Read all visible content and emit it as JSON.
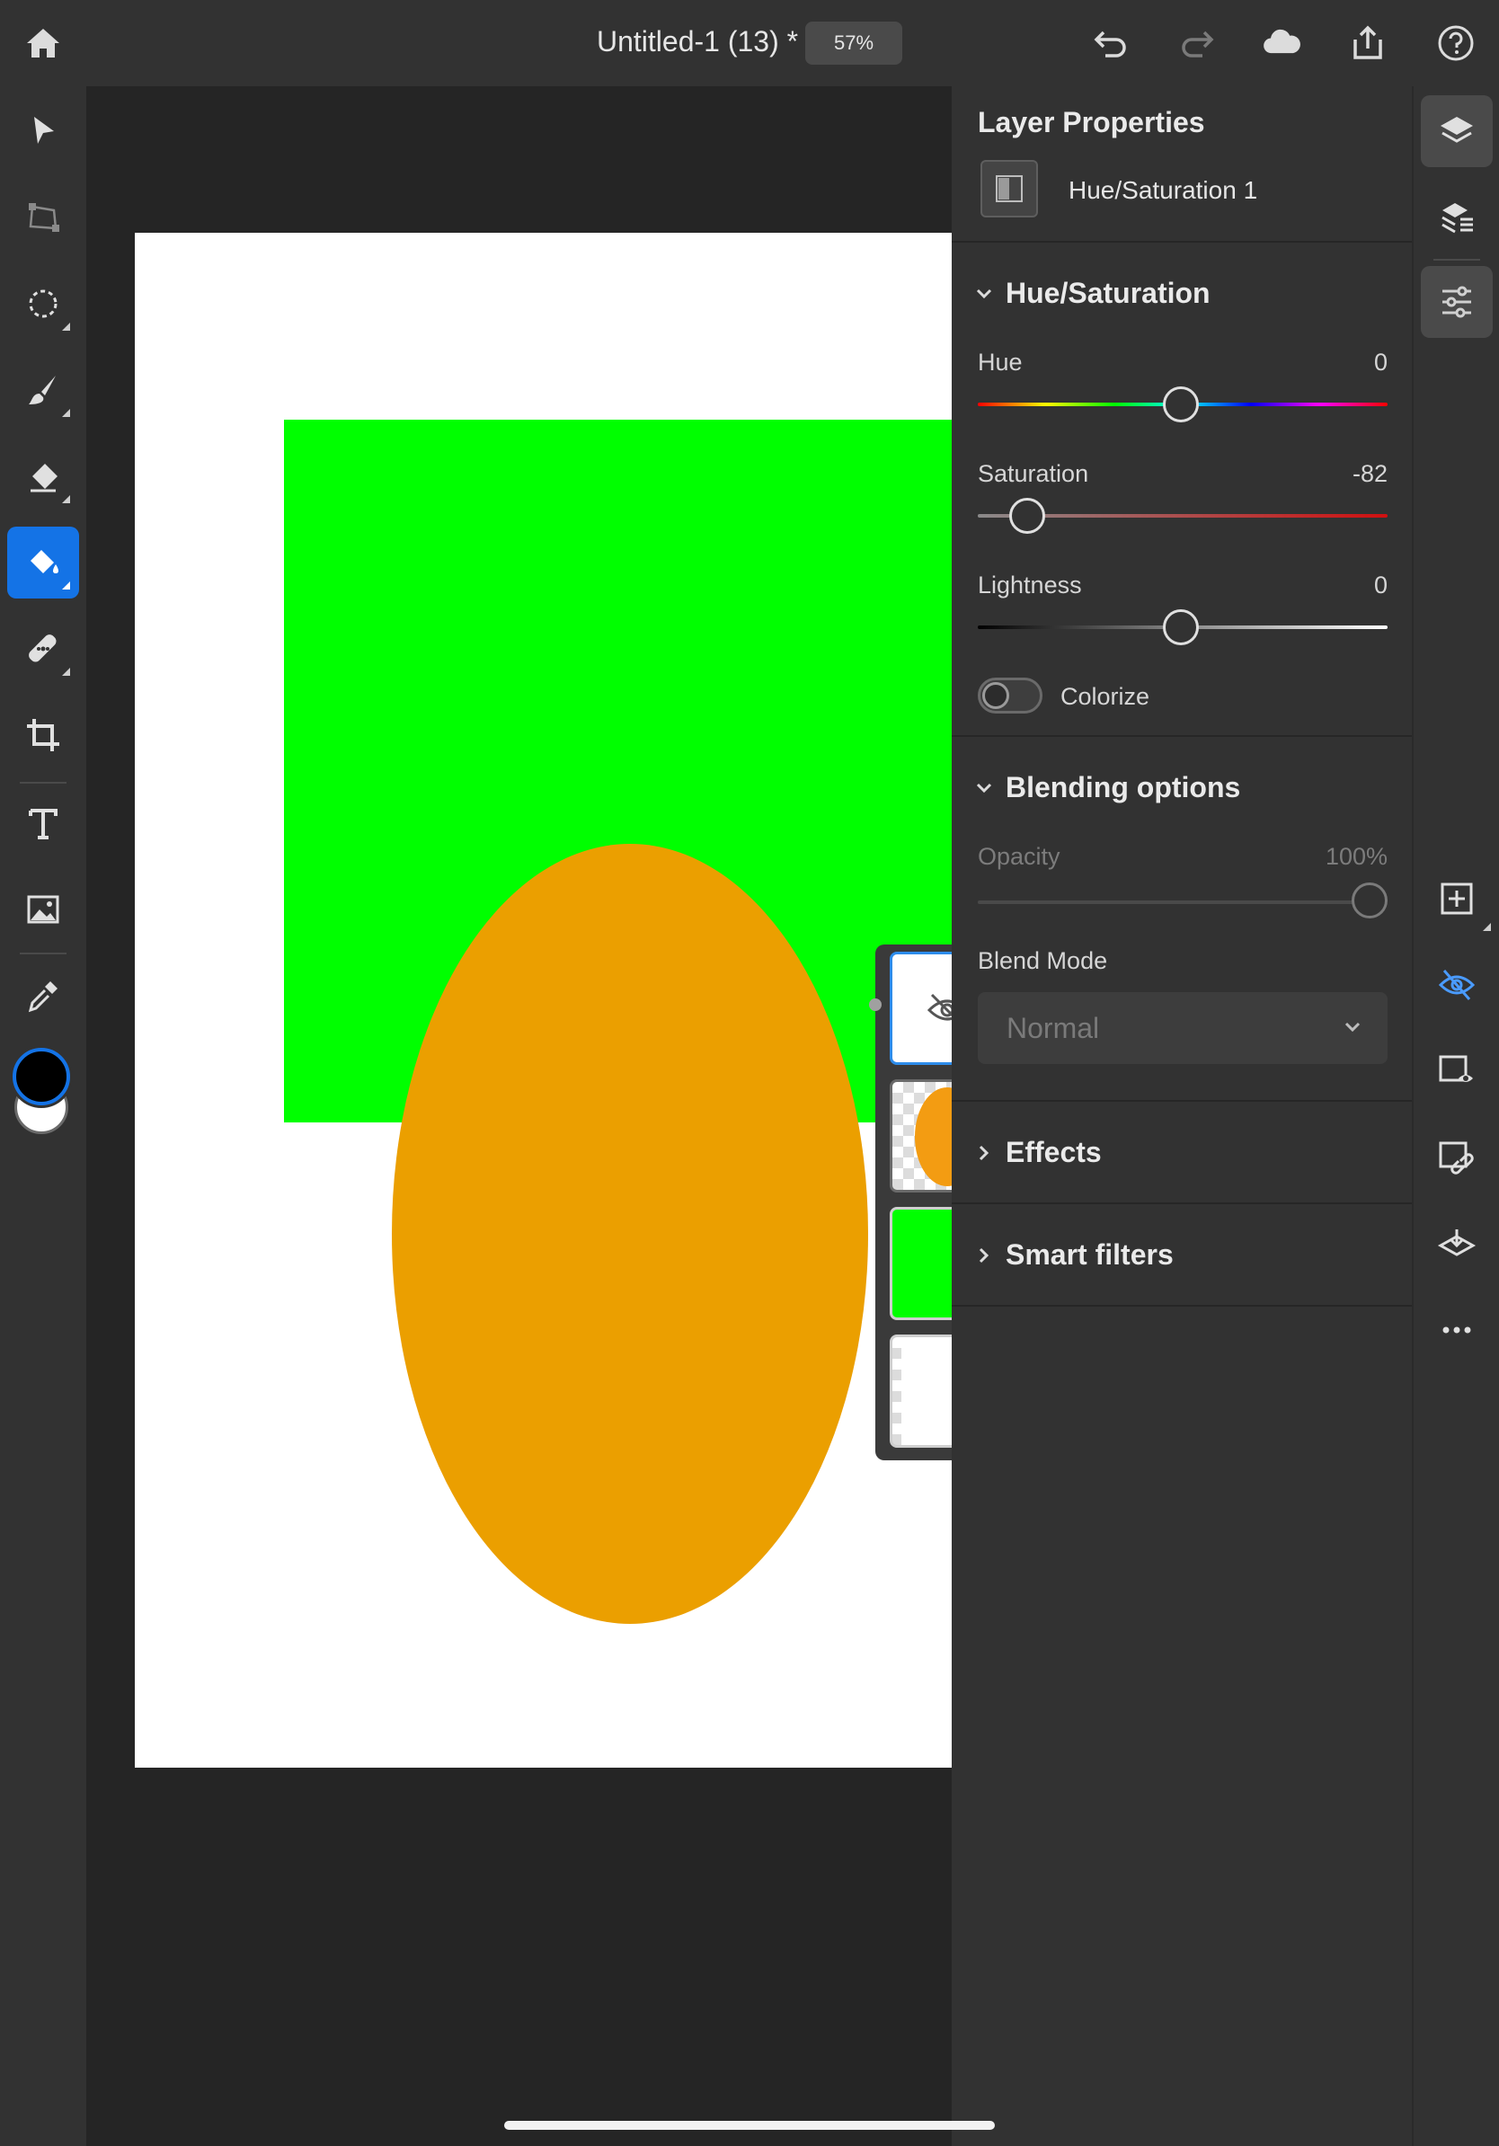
{
  "app": {
    "document_title": "Untitled-1 (13) *",
    "zoom": "57%"
  },
  "toolbar": {
    "left_tools": [
      {
        "icon": "select-arrow-icon",
        "active": false
      },
      {
        "icon": "transform-icon",
        "active": false
      },
      {
        "icon": "lasso-select-icon",
        "active": false
      },
      {
        "icon": "brush-icon",
        "active": false
      },
      {
        "icon": "eraser-icon",
        "active": false
      },
      {
        "icon": "paint-bucket-icon",
        "active": true
      },
      {
        "icon": "healing-brush-icon",
        "active": false
      },
      {
        "icon": "crop-icon",
        "active": false
      },
      {
        "icon": "text-icon",
        "active": false
      },
      {
        "icon": "place-image-icon",
        "active": false
      },
      {
        "icon": "eyedropper-icon",
        "active": false
      }
    ],
    "foreground_color": "#000000",
    "background_color": "#ffffff",
    "active_tool_color": "#1473e6"
  },
  "canvas": {
    "shapes": [
      {
        "type": "rectangle",
        "color": "#00ff00"
      },
      {
        "type": "ellipse",
        "color": "#eb9f00"
      }
    ]
  },
  "layers_popover": {
    "layers": [
      {
        "kind": "hue-saturation-adjustment",
        "hidden": true,
        "selected": true
      },
      {
        "kind": "orange-ellipse",
        "selected": false
      },
      {
        "kind": "green-fill",
        "selected": false
      },
      {
        "kind": "white-background",
        "selected": false
      }
    ]
  },
  "properties": {
    "title": "Layer Properties",
    "layer_name": "Hue/Saturation 1",
    "hue_saturation": {
      "heading": "Hue/Saturation",
      "hue_label": "Hue",
      "hue_value": "0",
      "saturation_label": "Saturation",
      "saturation_value": "-82",
      "lightness_label": "Lightness",
      "lightness_value": "0",
      "colorize_label": "Colorize",
      "colorize_on": false
    },
    "blending": {
      "heading": "Blending options",
      "opacity_label": "Opacity",
      "opacity_value": "100%",
      "blend_mode_label": "Blend Mode",
      "blend_mode_value": "Normal"
    },
    "effects_heading": "Effects",
    "smart_filters_heading": "Smart filters"
  },
  "rail": {
    "icons": [
      "layers-icon",
      "layer-stack-icon",
      "adjustments-icon",
      "add-layer-icon",
      "visibility-hidden-icon",
      "mask-icon",
      "clipping-mask-icon",
      "merge-layer-icon",
      "more-icon"
    ],
    "accent": "#4a9bff"
  }
}
